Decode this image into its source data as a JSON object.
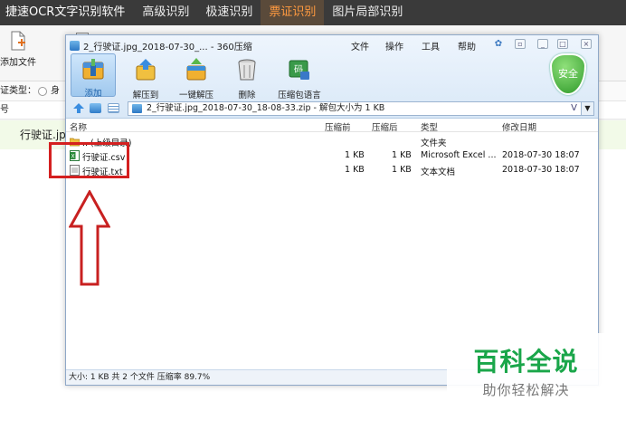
{
  "ocr_app": {
    "brand": "捷速OCR文字识别软件",
    "tabs": [
      "高级识别",
      "极速识别",
      "票证识别",
      "图片局部识别"
    ],
    "active_tab_index": 2,
    "add_file_label": "添加文件",
    "type_label": "证类型：",
    "radio_label": "身",
    "col_label": "号",
    "file_name": "行驶证.jpg"
  },
  "archive": {
    "title": "2_行驶证.jpg_2018-07-30_... - 360压缩",
    "menus": [
      "文件",
      "操作",
      "工具",
      "帮助"
    ],
    "tools": [
      {
        "label": "添加",
        "icon": "add-archive-icon"
      },
      {
        "label": "解压到",
        "icon": "extract-to-icon"
      },
      {
        "label": "一键解压",
        "icon": "one-click-extract-icon"
      },
      {
        "label": "删除",
        "icon": "delete-icon"
      },
      {
        "label": "压缩包语言",
        "icon": "archive-language-icon"
      }
    ],
    "security_badge": "安全",
    "address": "2_行驶证.jpg_2018-07-30_18-08-33.zip - 解包大小为 1 KB",
    "address_v": "V",
    "columns": [
      "名称",
      "压缩前",
      "压缩后",
      "类型",
      "修改日期"
    ],
    "rows": [
      {
        "name": ".. (上级目录)",
        "before": "",
        "after": "",
        "type": "文件夹",
        "date": "",
        "icon": "folder-icon"
      },
      {
        "name": "行驶证.csv",
        "before": "1 KB",
        "after": "1 KB",
        "type": "Microsoft Excel ...",
        "date": "2018-07-30 18:07",
        "icon": "excel-file-icon"
      },
      {
        "name": "行驶证.txt",
        "before": "1 KB",
        "after": "1 KB",
        "type": "文本文档",
        "date": "2018-07-30 18:07",
        "icon": "text-file-icon"
      }
    ],
    "status": "大小: 1 KB 共 2 个文件 压缩率 89.7%"
  },
  "watermark": {
    "title": "百科全说",
    "subtitle": "助你轻松解决"
  },
  "colors": {
    "highlight_red": "#d42020",
    "brand_green": "#1aa64a",
    "active_tab": "#ff9a40"
  }
}
